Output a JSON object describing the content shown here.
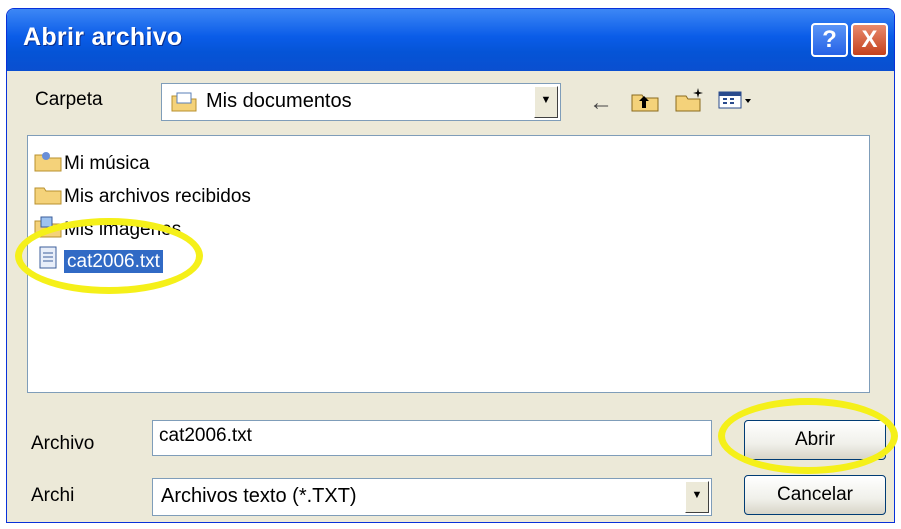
{
  "window": {
    "title": "Abrir archivo"
  },
  "titlebar_buttons": {
    "help": "?",
    "close": "X"
  },
  "folder": {
    "label": "Carpeta",
    "value": "Mis documentos"
  },
  "toolbar": {
    "icons": [
      "back-arrow-icon",
      "up-folder-icon",
      "new-folder-icon",
      "view-menu-icon"
    ]
  },
  "files": [
    {
      "name": "Mi música",
      "icon": "music-folder-icon",
      "selected": false
    },
    {
      "name": "Mis archivos recibidos",
      "icon": "folder-icon",
      "selected": false
    },
    {
      "name": "Mis imágenes",
      "icon": "pictures-folder-icon",
      "selected": false
    },
    {
      "name": "cat2006.txt",
      "icon": "text-file-icon",
      "selected": true
    }
  ],
  "filename": {
    "label": "Archivo",
    "value": "cat2006.txt"
  },
  "filetype": {
    "label": "Archi",
    "value": "Archivos texto (*.TXT)"
  },
  "buttons": {
    "open": "Abrir",
    "cancel": "Cancelar"
  },
  "colors": {
    "highlight": "#f5f019",
    "titlebar": "#0a5ce8",
    "selection": "#316ac5"
  }
}
